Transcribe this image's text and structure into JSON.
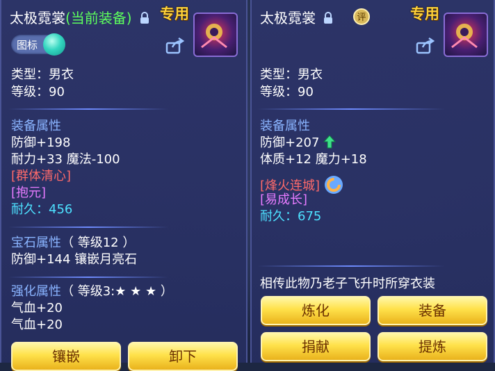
{
  "left": {
    "title_name": "太极霓裳",
    "title_state": "(当前装备)",
    "badge": "专用",
    "toggle_label": "图标",
    "type_line": "类型：男衣",
    "level_line": "等级：90",
    "section_equip": "装备属性",
    "attr1": "防御+198",
    "attr2": "耐力+33 魔法-100",
    "skill1": "[群体清心]",
    "skill2": "[抱元]",
    "dur_label": "耐久：",
    "dur_value": "456",
    "gem_title": "宝石属性",
    "gem_level": "（ 等级12 ）",
    "gem_effect": "防御+144 镶嵌月亮石",
    "strengthen_title": "强化属性",
    "strengthen_level": "（ 等级3:★ ★ ★ ）",
    "str1": "气血+20",
    "str2": "气血+20",
    "btn_inlay": "镶嵌",
    "btn_unequip": "卸下"
  },
  "right": {
    "title_name": "太极霓裳",
    "ping_label": "评",
    "badge": "专用",
    "type_line": "类型：男衣",
    "level_line": "等级：90",
    "section_equip": "装备属性",
    "attr1": "防御+207",
    "attr2": "体质+12 魔力+18",
    "skill1": "[烽火连城]",
    "skill2": "[易成长]",
    "dur_label": "耐久：",
    "dur_value": "675",
    "desc": "相传此物乃老子飞升时所穿衣装",
    "btn_refine": "炼化",
    "btn_equip": "装备",
    "btn_donate": "捐献",
    "btn_extract": "提炼"
  },
  "colors": {
    "title_green": "#5dff5d",
    "section_blue": "#8ab4ff",
    "skill_red": "#ff6a6a",
    "skill_purple": "#e77bff",
    "durability_cyan": "#4de1ff",
    "button_gold": "#ffe14a"
  },
  "icons": {
    "lock": "lock-icon",
    "share": "share-icon",
    "upgrade": "up-arrow-icon",
    "skill_ring": "refresh-ring-icon"
  }
}
